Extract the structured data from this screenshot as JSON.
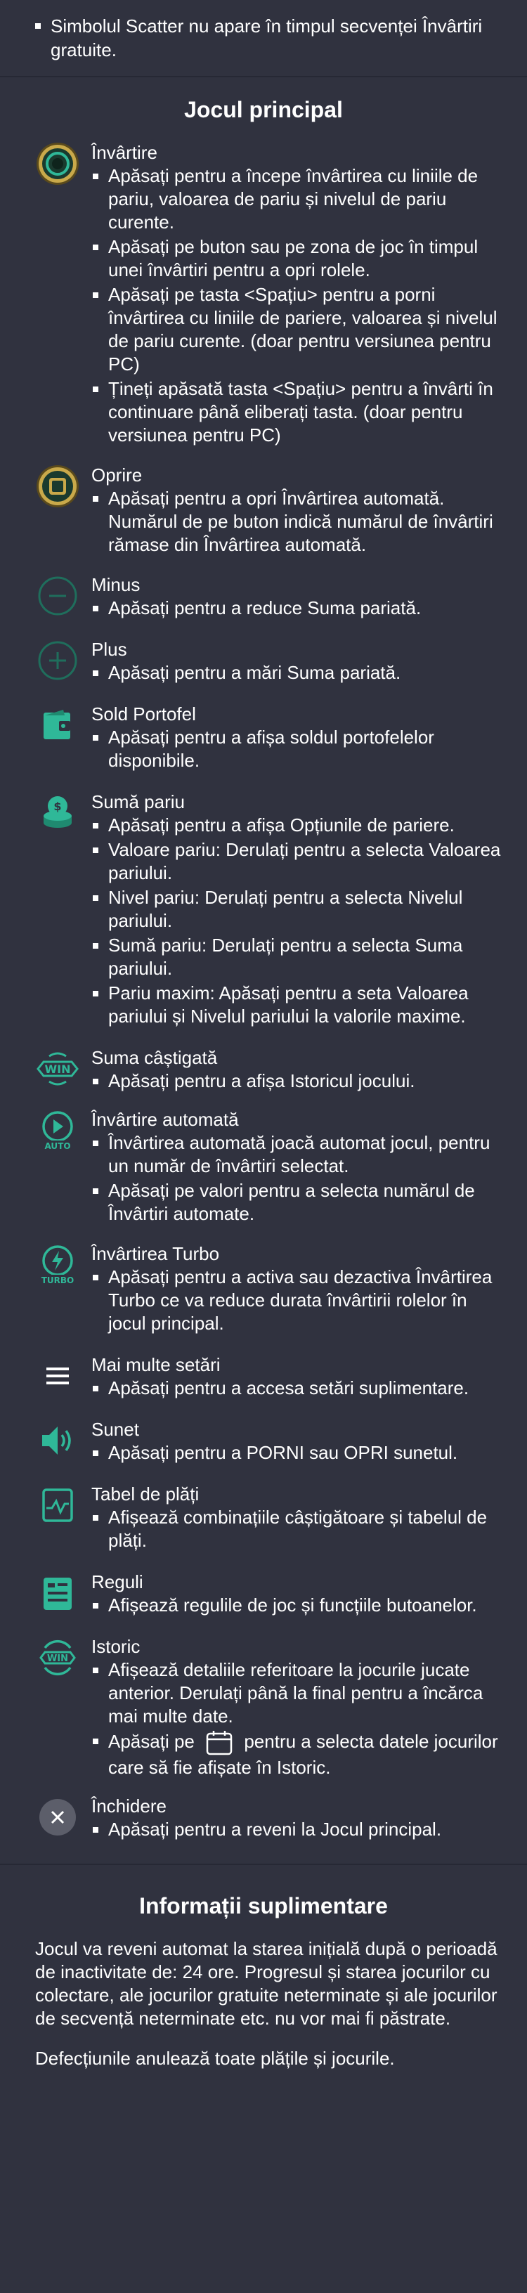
{
  "top_note": "Simbolul Scatter nu apare în timpul secvenței Învârtiri gratuite.",
  "main_title": "Jocul principal",
  "entries": [
    {
      "title": "Învârtire",
      "items": [
        "Apăsați pentru a începe învârtirea cu liniile de pariu, valoarea de pariu și nivelul de pariu curente.",
        "Apăsați pe buton sau pe zona de joc în timpul unei învârtiri pentru a opri rolele.",
        "Apăsați pe tasta <Spațiu> pentru a porni învârtirea cu liniile de pariere, valoarea și nivelul de pariu curente. (doar pentru versiunea pentru PC)",
        "Țineți apăsată tasta <Spațiu> pentru a învârti în continuare până eliberați tasta. (doar pentru versiunea pentru PC)"
      ]
    },
    {
      "title": "Oprire",
      "items": [
        "Apăsați pentru a opri Învârtirea automată. Numărul de pe buton indică numărul de învârtiri rămase din Învârtirea automată."
      ]
    },
    {
      "title": "Minus",
      "items": [
        "Apăsați pentru a reduce Suma pariată."
      ]
    },
    {
      "title": "Plus",
      "items": [
        "Apăsați pentru a mări Suma pariată."
      ]
    },
    {
      "title": "Sold Portofel",
      "items": [
        "Apăsați pentru a afișa soldul portofelelor disponibile."
      ]
    },
    {
      "title": "Sumă pariu",
      "items": [
        "Apăsați pentru a afișa Opțiunile de pariere.",
        "Valoare pariu: Derulați pentru a selecta Valoarea pariului.",
        "Nivel pariu: Derulați pentru a selecta Nivelul pariului.",
        "Sumă pariu: Derulați pentru a selecta Suma pariului.",
        "Pariu maxim: Apăsați pentru a seta Valoarea pariului și Nivelul pariului la valorile maxime."
      ]
    },
    {
      "title": "Suma câștigată",
      "items": [
        "Apăsați pentru a afișa Istoricul jocului."
      ]
    },
    {
      "title": "Învârtire automată",
      "items": [
        "Învârtirea automată joacă automat jocul, pentru un număr de învârtiri selectat.",
        "Apăsați pe valori pentru a selecta numărul de Învârtiri automate."
      ]
    },
    {
      "title": "Învârtirea Turbo",
      "items": [
        "Apăsați pentru a activa sau dezactiva Învârtirea Turbo ce va reduce durata învârtirii rolelor în jocul principal."
      ]
    },
    {
      "title": "Mai multe setări",
      "items": [
        "Apăsați pentru a accesa setări suplimentare."
      ]
    },
    {
      "title": "Sunet",
      "items": [
        "Apăsați pentru a PORNI sau OPRI sunetul."
      ]
    },
    {
      "title": "Tabel de plăți",
      "items": [
        "Afișează combinațiile câștigătoare și tabelul de plăți."
      ]
    },
    {
      "title": "Reguli",
      "items": [
        "Afișează regulile de joc și funcțiile butoanelor."
      ]
    },
    {
      "title": "Istoric",
      "items": [
        "Afișează detaliile referitoare la jocurile jucate anterior. Derulați până la final pentru a încărca mai multe date."
      ],
      "cal_before": "Apăsați pe",
      "cal_after": "pentru a selecta datele jocurilor care să fie afișate în Istoric."
    },
    {
      "title": "Închidere",
      "items": [
        "Apăsați pentru a reveni la Jocul principal."
      ]
    }
  ],
  "icons": {
    "win_text": "WIN",
    "auto_text": "AUTO",
    "turbo_text": "TURBO",
    "accent": "#2fb898",
    "gold": "#c9a94a"
  },
  "info_title": "Informații suplimentare",
  "info_paragraphs": [
    "Jocul va reveni automat la starea inițială după o perioadă de inactivitate de: 24 ore. Progresul și starea jocurilor cu colectare, ale jocurilor gratuite neterminate și ale jocurilor de secvență neterminate etc. nu vor mai fi păstrate.",
    "Defecțiunile anulează toate plățile și jocurile."
  ]
}
